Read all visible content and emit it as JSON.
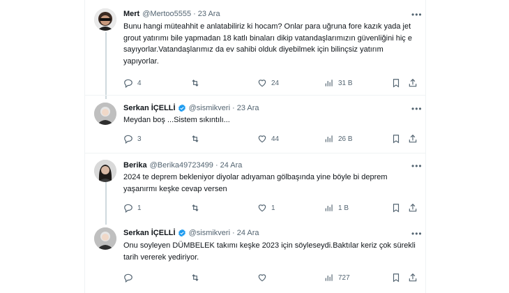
{
  "tweets": [
    {
      "name": "Mert",
      "handle": "@Mertoo5555",
      "time": "23 Ara",
      "verified": false,
      "text": "Bunu hangi müteahhit e anlatabiliriz ki hocam? Onlar para uğruna fore kazık yada jet grout yatırımı bile yapmadan 18 katlı binaları dikip vatandaşlarımızın güvenliğini hiç e sayıyorlar.Vatandaşlarımız da ev sahibi olduk diyebilmek için bilinçsiz yatırım yapıyorlar.",
      "replies": "4",
      "retweets": "",
      "likes": "24",
      "views": "31 B",
      "avatar_icon": "avatar-sunglasses"
    },
    {
      "name": "Serkan İÇELLİ",
      "handle": "@sismikveri",
      "time": "23 Ara",
      "verified": true,
      "text": "Meydan boş ...Sistem sıkıntılı...",
      "replies": "3",
      "retweets": "",
      "likes": "44",
      "views": "26 B",
      "avatar_icon": "avatar-man-gray"
    },
    {
      "name": "Berika",
      "handle": "@Berika49723499",
      "time": "24 Ara",
      "verified": false,
      "text": "2024 te deprem bekleniyor diyolar adıyaman gölbaşında yine böyle bi deprem yaşanırmı keşke cevap versen",
      "replies": "1",
      "retweets": "",
      "likes": "1",
      "views": "1 B",
      "avatar_icon": "avatar-woman"
    },
    {
      "name": "Serkan İÇELLİ",
      "handle": "@sismikveri",
      "time": "24 Ara",
      "verified": true,
      "text": "Onu soyleyen DÜMBELEK takımı keşke 2023 için söyleseydi.Baktılar keriz çok sürekli tarih vererek yediriyor.",
      "replies": "",
      "retweets": "",
      "likes": "",
      "views": "727",
      "avatar_icon": "avatar-man-gray"
    }
  ],
  "colors": {
    "text_primary": "#0f1419",
    "text_secondary": "#536471",
    "verified_blue": "#1d9bf0",
    "border": "#eff3f4",
    "thread_line": "#cfd9de"
  },
  "icons": {
    "reply": "reply-icon",
    "retweet": "retweet-icon",
    "like": "heart-icon",
    "views": "views-icon",
    "bookmark": "bookmark-icon",
    "share": "share-icon",
    "more": "more-icon",
    "verified": "verified-badge-icon"
  }
}
